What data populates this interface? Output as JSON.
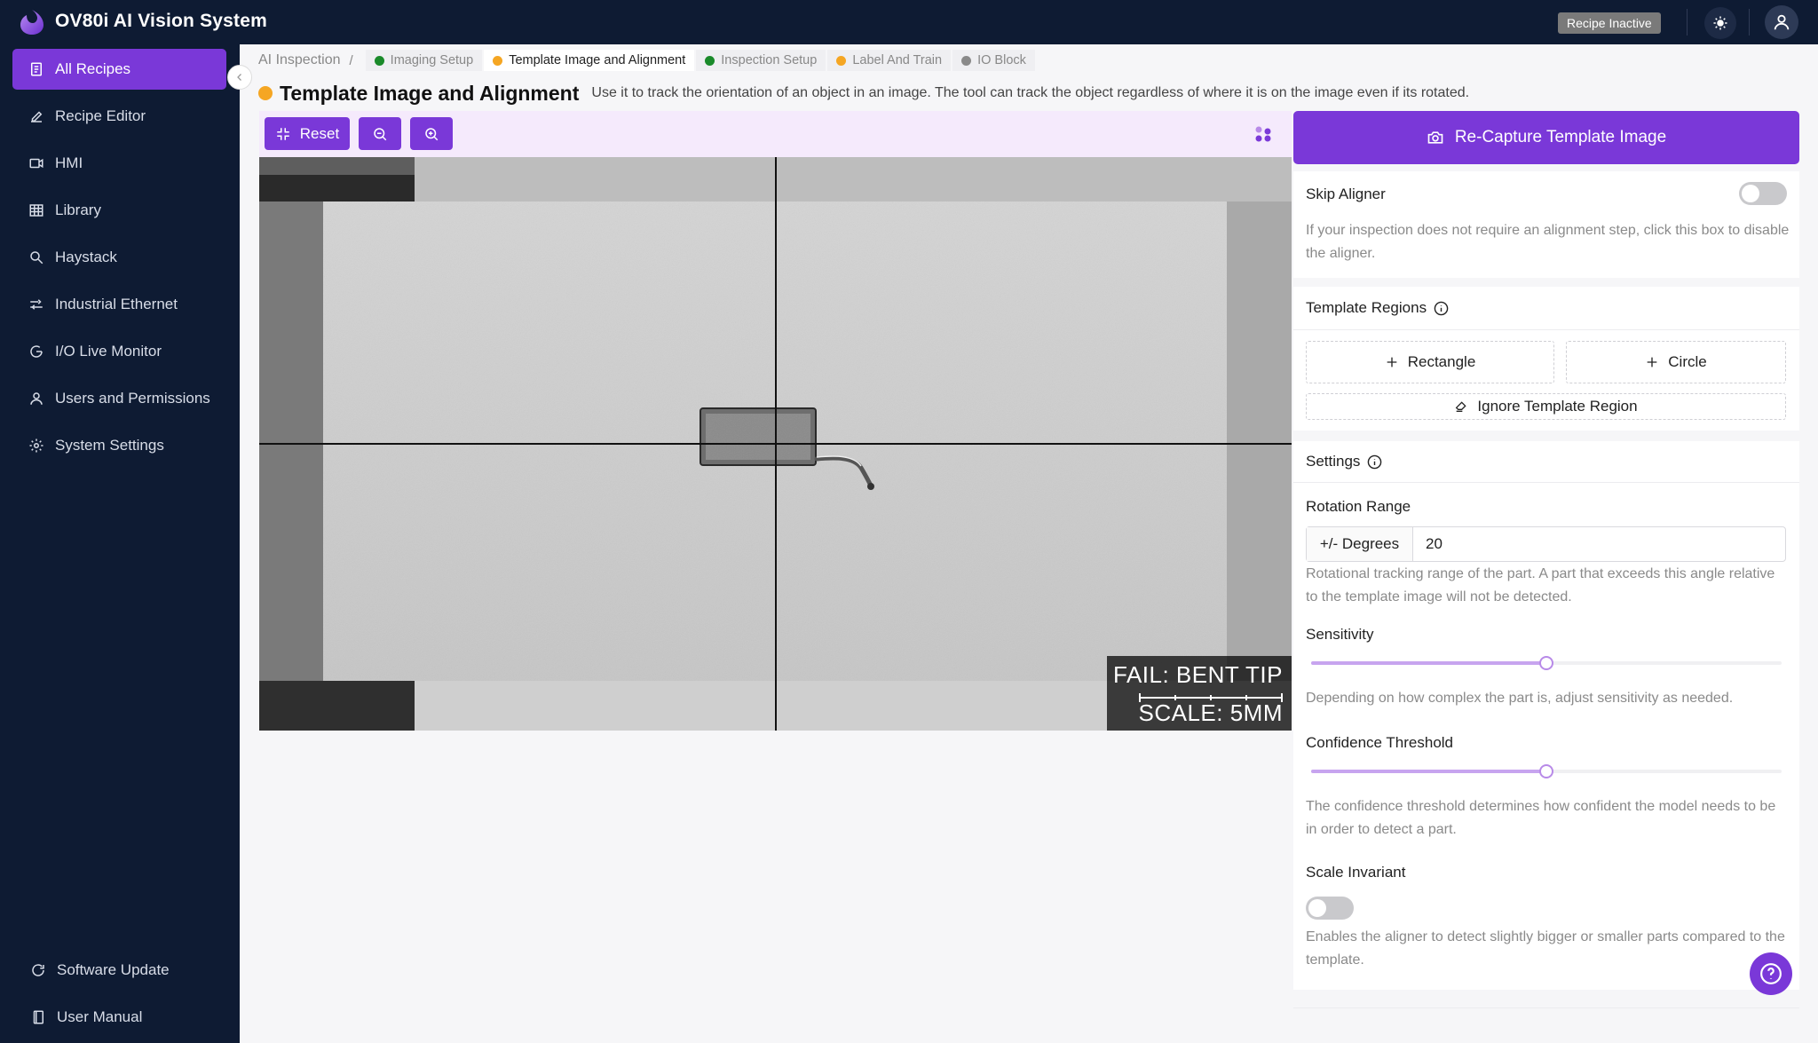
{
  "app": {
    "title": "OV80i AI Vision System",
    "recipe_status": "Recipe Inactive"
  },
  "sidebar": {
    "items": [
      {
        "label": "All Recipes",
        "icon": "document-icon",
        "active": true
      },
      {
        "label": "Recipe Editor",
        "icon": "pencil-icon"
      },
      {
        "label": "HMI",
        "icon": "video-icon"
      },
      {
        "label": "Library",
        "icon": "grid-icon"
      },
      {
        "label": "Haystack",
        "icon": "search-icon"
      },
      {
        "label": "Industrial Ethernet",
        "icon": "ethernet-icon"
      },
      {
        "label": "I/O Live Monitor",
        "icon": "monitor-icon"
      },
      {
        "label": "Users and Permissions",
        "icon": "user-icon"
      },
      {
        "label": "System Settings",
        "icon": "gear-icon"
      }
    ],
    "bottom_items": [
      {
        "label": "Software Update",
        "icon": "refresh-icon"
      },
      {
        "label": "User Manual",
        "icon": "book-icon"
      }
    ]
  },
  "breadcrumb": {
    "root": "AI Inspection",
    "separator": "/",
    "tabs": [
      {
        "label": "Imaging Setup",
        "status_color": "#1a8a2a"
      },
      {
        "label": "Template Image and Alignment",
        "status_color": "#f5a623",
        "active": true
      },
      {
        "label": "Inspection Setup",
        "status_color": "#1a8a2a"
      },
      {
        "label": "Label And Train",
        "status_color": "#f5a623"
      },
      {
        "label": "IO Block",
        "status_color": "#8a8a8a"
      }
    ]
  },
  "page": {
    "title": "Template Image and Alignment",
    "description": "Use it to track the orientation of an object in an image. The tool can track the object regardless of where it is on the image even if its rotated."
  },
  "toolbar": {
    "reset_label": "Reset",
    "zoom_out": "zoom-out-icon",
    "zoom_in": "zoom-in-icon"
  },
  "image_overlay": {
    "result": "FAIL: BENT TIP",
    "scale": "SCALE: 5MM"
  },
  "panel": {
    "recapture_label": "Re-Capture Template Image",
    "skip_aligner": {
      "label": "Skip Aligner",
      "enabled": false,
      "help": "If your inspection does not require an alignment step, click this box to disable the aligner."
    },
    "template_regions": {
      "title": "Template Regions",
      "rectangle_label": "Rectangle",
      "circle_label": "Circle",
      "ignore_label": "Ignore Template Region"
    },
    "settings": {
      "title": "Settings",
      "rotation_label": "Rotation Range",
      "rotation_addon": "+/- Degrees",
      "rotation_value": "20",
      "rotation_help": "Rotational tracking range of the part. A part that exceeds this angle relative to the template image will not be detected.",
      "sensitivity_label": "Sensitivity",
      "sensitivity_value": 0.5,
      "sensitivity_help": "Depending on how complex the part is, adjust sensitivity as needed.",
      "confidence_label": "Confidence Threshold",
      "confidence_value": 0.5,
      "confidence_help": "The confidence threshold determines how confident the model needs to be in order to detect a part.",
      "scale_invariant_label": "Scale Invariant",
      "scale_invariant_enabled": false,
      "scale_invariant_help": "Enables the aligner to detect slightly bigger or smaller parts compared to the template."
    }
  },
  "colors": {
    "accent": "#7a38d8",
    "sidebar_bg": "#0e1b33"
  }
}
